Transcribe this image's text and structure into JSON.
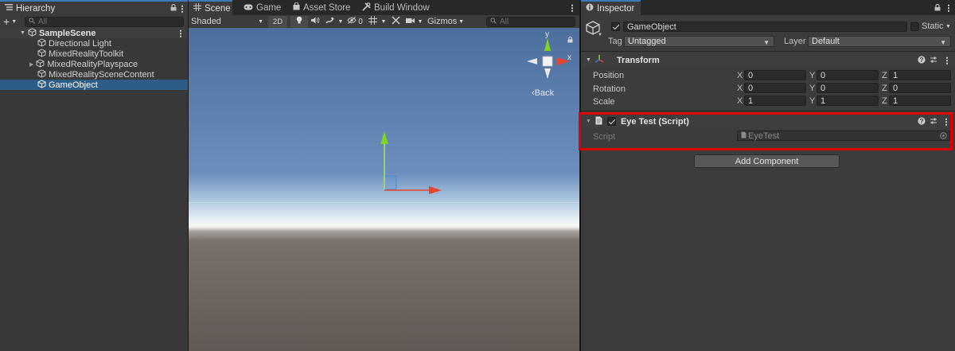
{
  "hierarchy": {
    "tab_label": "Hierarchy",
    "add_label": "+",
    "search_placeholder": "All",
    "scene_name": "SampleScene",
    "items": [
      {
        "label": "Directional Light"
      },
      {
        "label": "MixedRealityToolkit"
      },
      {
        "label": "MixedRealityPlayspace"
      },
      {
        "label": "MixedRealitySceneContent"
      },
      {
        "label": "GameObject"
      }
    ]
  },
  "scene": {
    "tabs": [
      {
        "label": "Scene"
      },
      {
        "label": "Game"
      },
      {
        "label": "Asset Store"
      },
      {
        "label": "Build Window"
      }
    ],
    "toolbar": {
      "shading_mode": "Shaded",
      "mode_2d": "2D",
      "hidden_count": "0",
      "gizmos_label": "Gizmos",
      "search_placeholder": "All"
    },
    "gizmo": {
      "x_label": "x",
      "y_label": "y",
      "view_label": "‹Back"
    }
  },
  "inspector": {
    "tab_label": "Inspector",
    "object_name": "GameObject",
    "static_label": "Static",
    "tag_label": "Tag",
    "tag_value": "Untagged",
    "layer_label": "Layer",
    "layer_value": "Default",
    "transform": {
      "title": "Transform",
      "rows": [
        {
          "label": "Position",
          "x": "0",
          "y": "0",
          "z": "1"
        },
        {
          "label": "Rotation",
          "x": "0",
          "y": "0",
          "z": "0"
        },
        {
          "label": "Scale",
          "x": "1",
          "y": "1",
          "z": "1"
        }
      ],
      "axis_x": "X",
      "axis_y": "Y",
      "axis_z": "Z"
    },
    "script_component": {
      "title": "Eye Test (Script)",
      "script_label": "Script",
      "script_value": "EyeTest"
    },
    "add_component_label": "Add Component"
  },
  "colors": {
    "highlight": "#e00000",
    "selection": "#2c5d87",
    "axis_x": "#e8462c",
    "axis_y": "#7ed321",
    "axis_z": "#3a7bd5"
  }
}
